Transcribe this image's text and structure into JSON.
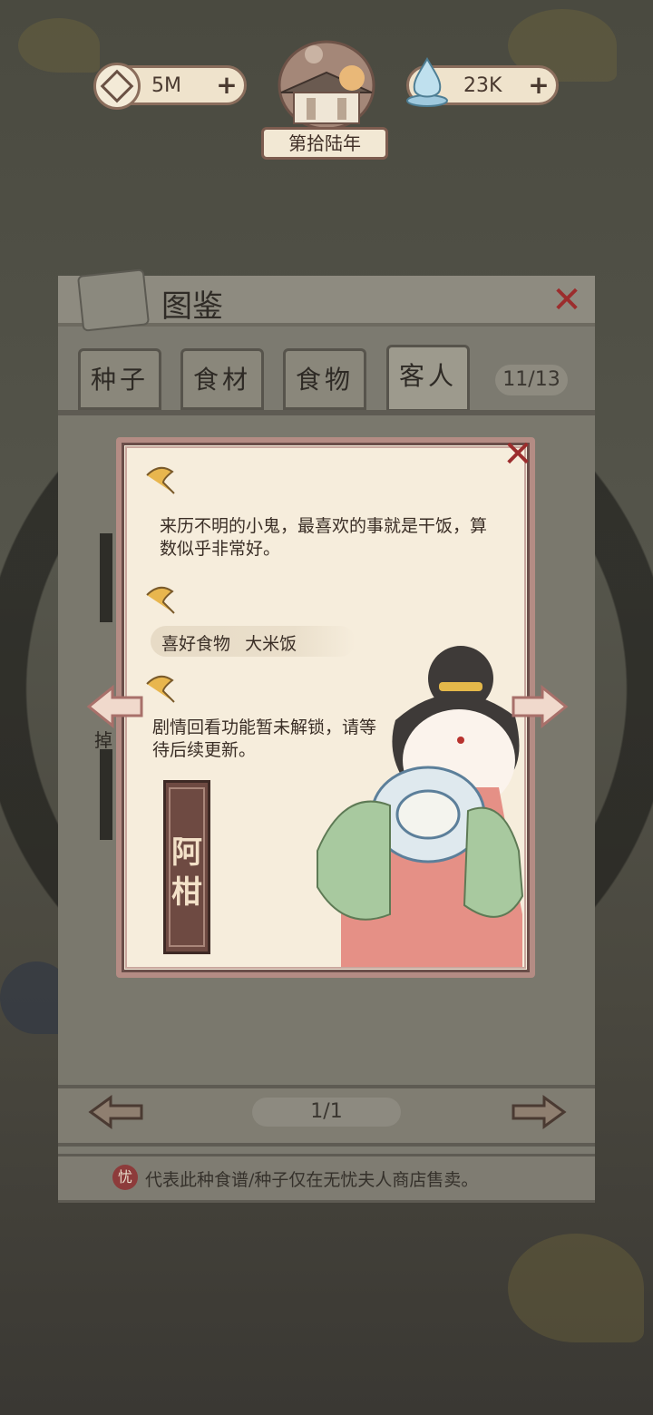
{
  "header": {
    "coins": "5M",
    "water": "23K",
    "plus": "+",
    "year": "第拾陆年"
  },
  "panel": {
    "title": "图鉴",
    "tabs": [
      {
        "label": "种子",
        "active": false
      },
      {
        "label": "食材",
        "active": false
      },
      {
        "label": "食物",
        "active": false
      },
      {
        "label": "客人",
        "active": true
      }
    ],
    "count": "11/13",
    "page": "1/1",
    "side_text": "掉",
    "notice_icon": "忧",
    "notice": "代表此种食谱/种子仅在无忧夫人商店售卖。"
  },
  "card": {
    "description": "来历不明的小鬼，最喜欢的事就是干饭，算数似乎非常好。",
    "favorite_label": "喜好食物",
    "favorite_food": "大米饭",
    "story_locked": "剧情回看功能暂未解锁，请等待后续更新。",
    "name": "阿柑"
  },
  "colors": {
    "accent_red": "#9c2d2d",
    "card_bg": "#f6eddc",
    "border": "#b48c84"
  },
  "icons": [
    "diamond-coin-icon",
    "water-drop-icon",
    "plus-icon",
    "close-icon",
    "ginkgo-leaf-icon",
    "arrow-left-icon",
    "arrow-right-icon"
  ]
}
